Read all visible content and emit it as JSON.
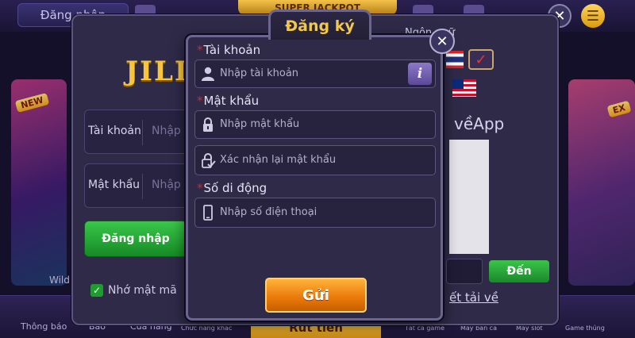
{
  "header": {
    "login_button": "Đăng nhập",
    "jackpot": "SUPER JACKPOT",
    "close": "✕",
    "menu": "☰"
  },
  "lobby": {
    "tag_new": "NEW",
    "tag_ex": "EX",
    "card_left_caption": "Wild",
    "nav": [
      {
        "label": "Thông báo"
      },
      {
        "label": "Bảo"
      },
      {
        "label": "Cửa hàng"
      },
      {
        "label": "Chức năng khác"
      },
      {
        "label": "Tất cả game"
      },
      {
        "label": "Máy bắn cá"
      },
      {
        "label": "Máy slot"
      },
      {
        "label": "Game thủng"
      }
    ],
    "cashout": "Rút tiền"
  },
  "login_dialog": {
    "logo": "JILI",
    "account_label": "Tài khoản",
    "account_placeholder": "Nhập",
    "password_label": "Mật khẩu",
    "password_placeholder": "Nhập",
    "login_button": "Đăng nhập",
    "remember_label": "Nhớ mật mã",
    "remember_checked": true,
    "language_label": "Ngôn ngữ",
    "download_title": "vềApp",
    "go_button": "Đến",
    "download_link": "ết tải về"
  },
  "register": {
    "title": "Đăng ký",
    "close": "✕",
    "required_mark": "*",
    "account_label": "Tài khoản",
    "account_placeholder": "Nhập tài khoản",
    "info_button": "i",
    "password_label": "Mật khẩu",
    "password_placeholder": "Nhập mật khẩu",
    "confirm_placeholder": "Xác nhận lại mật khẩu",
    "phone_label": "Số di động",
    "phone_placeholder": "Nhập số điện thoại",
    "submit": "Gửi"
  },
  "icons": {
    "user": "user-icon",
    "lock": "lock-icon",
    "lock_check": "lock-check-icon",
    "phone": "phone-icon"
  },
  "colors": {
    "accent_title": "#f2c84a",
    "required": "#e0202a",
    "submit": "#e87808",
    "go": "#19892a"
  }
}
